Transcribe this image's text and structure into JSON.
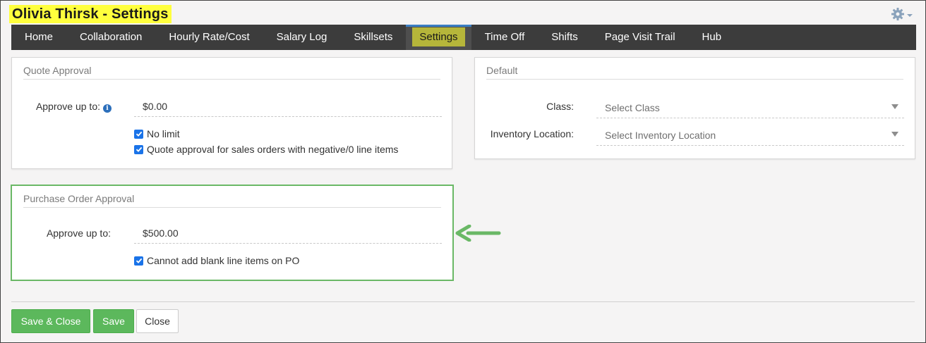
{
  "header": {
    "title": "Olivia Thirsk - Settings",
    "settings_icon": "gear-icon"
  },
  "nav": {
    "items": [
      {
        "label": "Home"
      },
      {
        "label": "Collaboration"
      },
      {
        "label": "Hourly Rate/Cost"
      },
      {
        "label": "Salary Log"
      },
      {
        "label": "Skillsets"
      },
      {
        "label": "Settings",
        "active": true
      },
      {
        "label": "Time Off"
      },
      {
        "label": "Shifts"
      },
      {
        "label": "Page Visit Trail"
      },
      {
        "label": "Hub"
      }
    ]
  },
  "quote_approval": {
    "title": "Quote Approval",
    "approve_label": "Approve up to:",
    "approve_value": "$0.00",
    "no_limit_label": "No limit",
    "no_limit_checked": true,
    "negative_label": "Quote approval for sales orders with negative/0 line items",
    "negative_checked": true
  },
  "default": {
    "title": "Default",
    "class_label": "Class:",
    "class_placeholder": "Select Class",
    "location_label": "Inventory Location:",
    "location_placeholder": "Select Inventory Location"
  },
  "po_approval": {
    "title": "Purchase Order Approval",
    "approve_label": "Approve up to:",
    "approve_value": "$500.00",
    "blank_lines_label": "Cannot add blank line items on PO",
    "blank_lines_checked": true
  },
  "footer": {
    "save_close_label": "Save & Close",
    "save_label": "Save",
    "close_label": "Close"
  },
  "colors": {
    "highlight": "#ffff3d",
    "nav_bg": "#3c3c3c",
    "active_tab": "#b6b63a",
    "accent_green": "#5cb85c",
    "callout_green": "#6ab866",
    "checkbox_blue": "#1a73e8"
  }
}
